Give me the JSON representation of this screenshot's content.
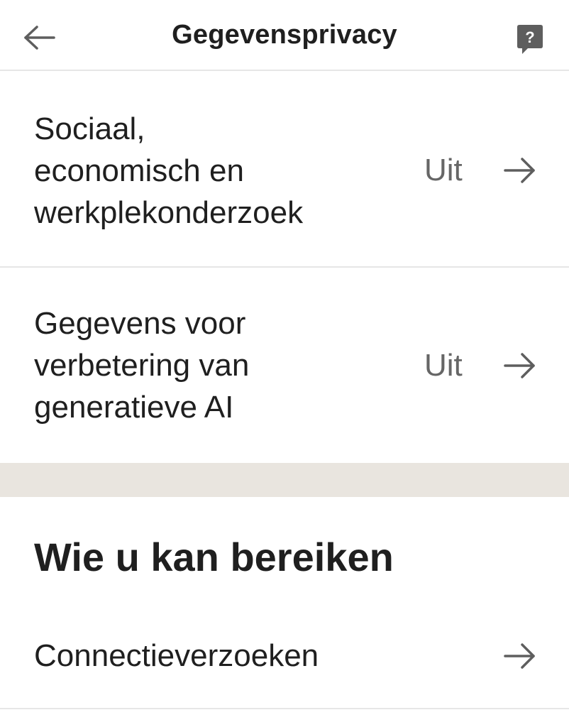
{
  "header": {
    "title": "Gegevensprivacy",
    "back_icon": "arrow-left-icon",
    "help_icon": "help-question-icon"
  },
  "rows": [
    {
      "label": "Sociaal,\neconomisch en\nwerkplekonderzoek",
      "value": "Uit",
      "icon": "arrow-right-icon"
    },
    {
      "label": "Gegevens voor\nverbetering van\ngeneratieve AI",
      "value": "Uit",
      "icon": "arrow-right-icon"
    }
  ],
  "section": {
    "heading": "Wie u kan bereiken",
    "rows": [
      {
        "label": "Connectieverzoeken",
        "icon": "arrow-right-icon"
      }
    ]
  },
  "colors": {
    "text": "#1f1f1f",
    "secondary_text": "#666666",
    "section_gap": "#e9e5df",
    "divider": "#e6e6e6",
    "icon": "#5e5e5e"
  }
}
